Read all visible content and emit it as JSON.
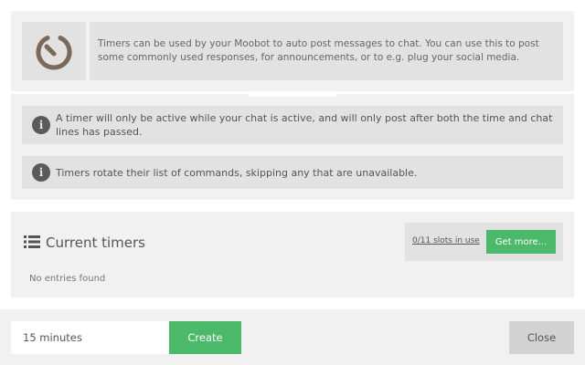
{
  "intro": {
    "icon": "stopwatch-icon",
    "text": "Timers can be used by your Moobot to auto post messages to chat. You can use this to post some commonly used responses, for announcements, or to e.g. plug your social media."
  },
  "notices": [
    {
      "icon": "info-icon",
      "glyph": "i",
      "text": "A timer will only be active while your chat is active, and will only post after both the time and chat lines has passed."
    },
    {
      "icon": "info-icon",
      "glyph": "i",
      "text": "Timers rotate their list of commands, skipping any that are unavailable."
    }
  ],
  "timers": {
    "icon": "list-icon",
    "title": "Current timers",
    "slots_text": "0/11 slots in use",
    "get_more_label": "Get more...",
    "empty_text": "No entries found"
  },
  "footer": {
    "duration_value": "15 minutes",
    "create_label": "Create",
    "close_label": "Close"
  },
  "colors": {
    "accent_green": "#4cb86a",
    "panel_bg": "#f1f1f1",
    "box_bg": "#e2e2e2",
    "icon_brown": "#7a6a5a"
  }
}
